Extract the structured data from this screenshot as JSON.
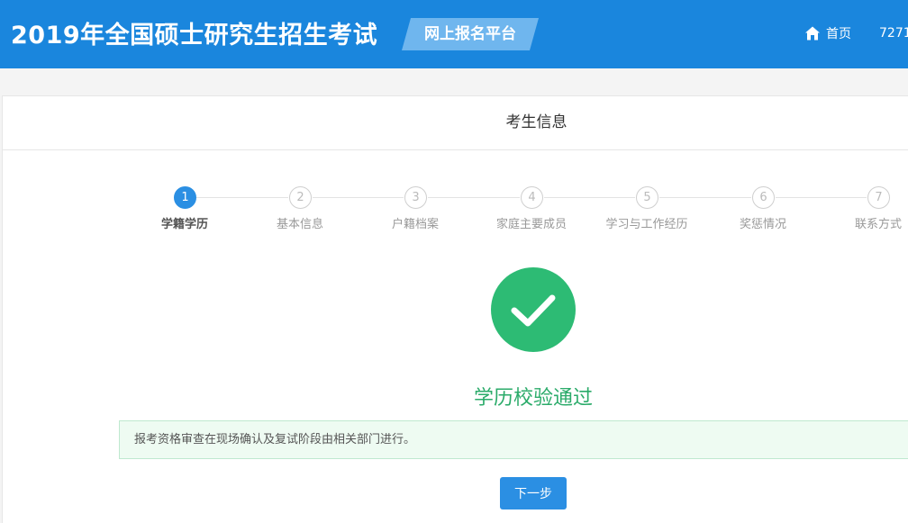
{
  "header": {
    "site_title": "2019年全国硕士研究生招生考试",
    "platform_badge": "网上报名平台",
    "home_label": "首页",
    "user_code": "7271"
  },
  "panel": {
    "title": "考生信息"
  },
  "steps": [
    {
      "number": "1",
      "label": "学籍学历",
      "active": true
    },
    {
      "number": "2",
      "label": "基本信息",
      "active": false
    },
    {
      "number": "3",
      "label": "户籍档案",
      "active": false
    },
    {
      "number": "4",
      "label": "家庭主要成员",
      "active": false
    },
    {
      "number": "5",
      "label": "学习与工作经历",
      "active": false
    },
    {
      "number": "6",
      "label": "奖惩情况",
      "active": false
    },
    {
      "number": "7",
      "label": "联系方式",
      "active": false
    }
  ],
  "result": {
    "status_icon": "check-icon",
    "message": "学历校验通过"
  },
  "notice": {
    "text": "报考资格审查在现场确认及复试阶段由相关部门进行。"
  },
  "actions": {
    "next_label": "下一步"
  },
  "colors": {
    "header_bg": "#1a86dd",
    "primary": "#2b8fe3",
    "success": "#2dbb74",
    "success_text": "#2bab6a",
    "notice_bg": "#eefbf2"
  }
}
